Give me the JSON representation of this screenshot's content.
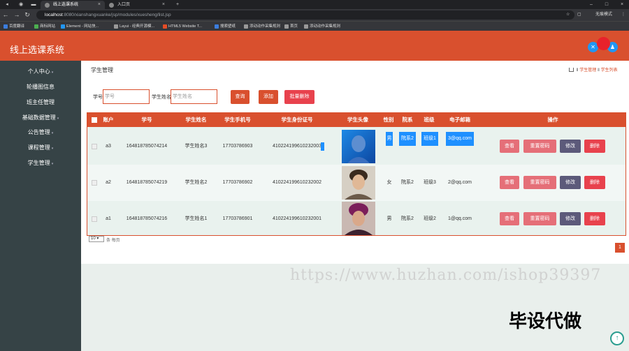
{
  "browser": {
    "tabs": [
      {
        "title": "线上选课系统",
        "active": true
      },
      {
        "title": "入口页",
        "active": false
      }
    ],
    "new_tab": "+",
    "url_host": "localhost",
    "url_path": ":8080/xianshangxuanke/jsp/modules/xuesheng/list.jsp",
    "profile_label": "无痕模式",
    "bookmarks": [
      "百度翻译",
      "商标网站",
      "Element - 网站快...",
      "Layui - 经典开源模...",
      "HTML5 Website T...",
      "搜索壁纸",
      "添动动作采集规则",
      "首页",
      "添动动作采集规则"
    ]
  },
  "header": {
    "app_title": "线上选课系统",
    "colors": {
      "brand": "#d9502e",
      "sidebar": "#364346"
    }
  },
  "sidebar": {
    "items": [
      {
        "label": "个人中心",
        "chevron": true
      },
      {
        "label": "轮播图信息",
        "chevron": false
      },
      {
        "label": "班主任管理",
        "chevron": false
      },
      {
        "label": "基础数据管理",
        "chevron": true
      },
      {
        "label": "公告管理",
        "chevron": true
      },
      {
        "label": "课程管理",
        "chevron": true
      },
      {
        "label": "学生管理",
        "chevron": true
      }
    ]
  },
  "page": {
    "title": "学生管理",
    "breadcrumb": [
      "学生管理",
      "学生列表"
    ]
  },
  "search": {
    "id_label": "学号",
    "id_placeholder": "学号",
    "name_label": "学生姓名",
    "name_placeholder": "学生姓名",
    "query_btn": "查询",
    "add_btn": "添加",
    "batch_delete_btn": "批量删除"
  },
  "table": {
    "headers": [
      "账户",
      "学号",
      "学生姓名",
      "学生手机号",
      "学生身份证号",
      "学生头像",
      "性别",
      "院系",
      "班级",
      "电子邮箱",
      "操作"
    ],
    "rows": [
      {
        "account": "a3",
        "student_id": "164818785074214",
        "name": "学生姓名3",
        "phone": "17703786903",
        "id_card": "410224199610232003",
        "gender": "男",
        "department": "院系2",
        "class": "班级1",
        "email": "3@qq.com"
      },
      {
        "account": "a2",
        "student_id": "164818785074219",
        "name": "学生姓名2",
        "phone": "17703786902",
        "id_card": "410224199610232002",
        "gender": "女",
        "department": "院系2",
        "class": "班级3",
        "email": "2@qq.com"
      },
      {
        "account": "a1",
        "student_id": "164818785074216",
        "name": "学生姓名1",
        "phone": "17703786901",
        "id_card": "410224199610232001",
        "gender": "男",
        "department": "院系2",
        "class": "班级2",
        "email": "1@qq.com"
      }
    ],
    "actions": {
      "view": "查看",
      "reset_pwd": "重置密码",
      "edit": "修改",
      "delete": "删除"
    }
  },
  "pager": {
    "per_page": "10",
    "per_page_suffix": "条 每页",
    "current_page": "1"
  },
  "overlay": {
    "watermark": "https://www.huzhan.com/ishop39397",
    "badge": "毕设代做",
    "back_to_top": "↑"
  }
}
